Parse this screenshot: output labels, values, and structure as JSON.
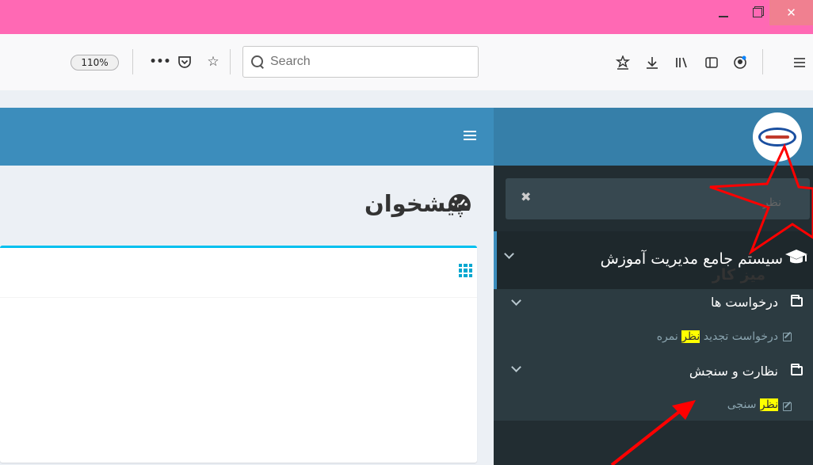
{
  "browser": {
    "zoom": "110%",
    "search_placeholder": "Search",
    "window_controls": {
      "close": "✕"
    }
  },
  "header": {
    "menu_icon": "hamburger-icon",
    "logo_icon": "institute-logo"
  },
  "sidebar": {
    "search_value": "نظر",
    "search_clear": "✖",
    "main_menu": "سیستم جامع مدیریت آموزش",
    "groups": [
      {
        "label": "درخواست ها",
        "items": [
          {
            "before": "درخواست تجدید ",
            "highlight": "نظر",
            "after": " نمره"
          }
        ]
      },
      {
        "label": "نظارت و سنجش",
        "items": [
          {
            "before": "",
            "highlight": "نظر",
            "after": " سنجی"
          }
        ]
      }
    ]
  },
  "content": {
    "page_title": "پیشخوان",
    "box_title": "میز کار"
  },
  "colors": {
    "titlebar": "#ff69b4",
    "navbar": "#3c8dbc",
    "sidebar": "#222d32",
    "annotation": "#ff0000",
    "highlight": "#ffff00"
  }
}
